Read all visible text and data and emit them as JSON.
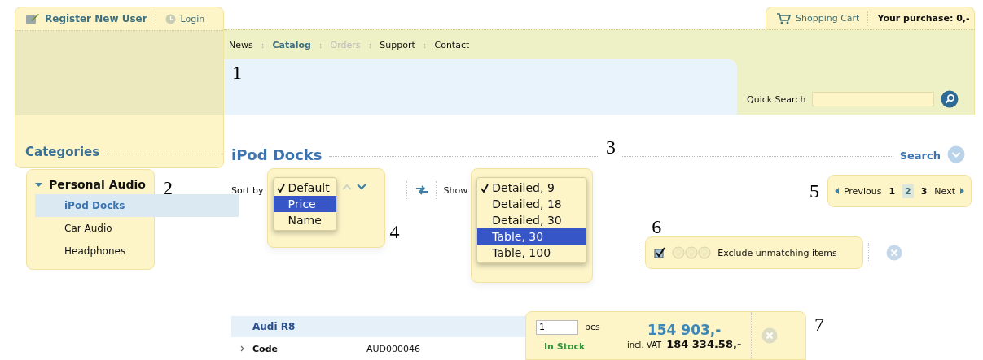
{
  "header": {
    "register_link": "Register New User",
    "login_link": "Login",
    "cart_link": "Shopping Cart",
    "purchase": "Your purchase: 0,-"
  },
  "nav": [
    {
      "label": "News",
      "selected": false,
      "disabled": false
    },
    {
      "label": "Catalog",
      "selected": true,
      "disabled": false,
      "separator": ":"
    },
    {
      "label": "Orders",
      "selected": false,
      "disabled": true,
      "separator": ":"
    },
    {
      "label": "Support",
      "selected": false,
      "disabled": false,
      "separator": ":"
    },
    {
      "label": "Contact",
      "selected": false,
      "disabled": false,
      "separator": ":"
    }
  ],
  "quick_search": {
    "label": "Quick Search"
  },
  "categories_title": "Categories",
  "heading": "iPod Docks",
  "search_button": "Search",
  "categories": [
    {
      "label": "Personal Audio",
      "expanded": true,
      "children": [
        {
          "label": "iPod Docks",
          "selected": true
        },
        {
          "label": "Car Audio",
          "selected": false
        },
        {
          "label": "Headphones",
          "selected": false
        }
      ]
    }
  ],
  "sort": {
    "label": "Sort by",
    "options": [
      {
        "label": "Default",
        "checked": true,
        "selected": false
      },
      {
        "label": "Price",
        "checked": false,
        "selected": true
      },
      {
        "label": "Name",
        "checked": false,
        "selected": false
      }
    ]
  },
  "show": {
    "label": "Show",
    "options": [
      {
        "label": "Detailed, 9",
        "checked": true,
        "selected": false
      },
      {
        "label": "Detailed, 18",
        "checked": false,
        "selected": false
      },
      {
        "label": "Detailed, 30",
        "checked": false,
        "selected": false
      },
      {
        "label": "Table, 30",
        "checked": false,
        "selected": true
      },
      {
        "label": "Table, 100",
        "checked": false,
        "selected": false
      }
    ]
  },
  "pagination": {
    "previous": "Previous",
    "next": "Next",
    "pages": [
      {
        "label": "1",
        "selected": false
      },
      {
        "label": "2",
        "selected": true
      },
      {
        "label": "3",
        "selected": false
      }
    ]
  },
  "filter": {
    "checked": true,
    "label": "Exclude unmatching items"
  },
  "product": {
    "name": "Audi R8",
    "code_label": "Code",
    "code": "AUD000046",
    "quantity": "1",
    "unit": "pcs",
    "stock": "In Stock",
    "price": "154 903,-",
    "vat_label": "incl. VAT",
    "vat_price": "184 334.58,-"
  },
  "annotations": [
    "1",
    "2",
    "3",
    "4",
    "5",
    "6",
    "7"
  ]
}
